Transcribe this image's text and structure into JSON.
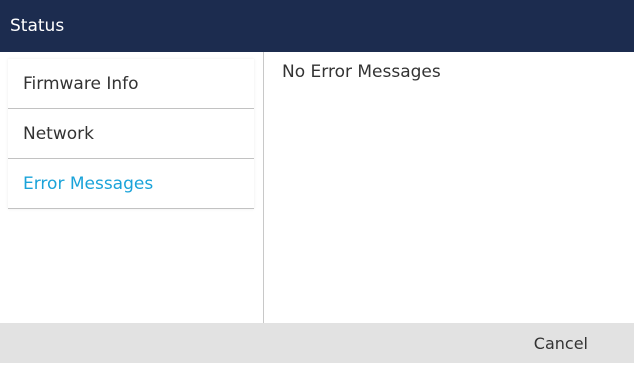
{
  "header": {
    "title": "Status"
  },
  "sidebar": {
    "items": [
      {
        "label": "Firmware Info",
        "active": false
      },
      {
        "label": "Network",
        "active": false
      },
      {
        "label": "Error Messages",
        "active": true
      }
    ],
    "active_color": "#1aa3d9"
  },
  "main": {
    "message": "No Error Messages"
  },
  "softkeys": {
    "cancel_label": "Cancel"
  },
  "colors": {
    "title_bar": "#1c2c4f",
    "softkey_bar": "#e2e2e2"
  }
}
